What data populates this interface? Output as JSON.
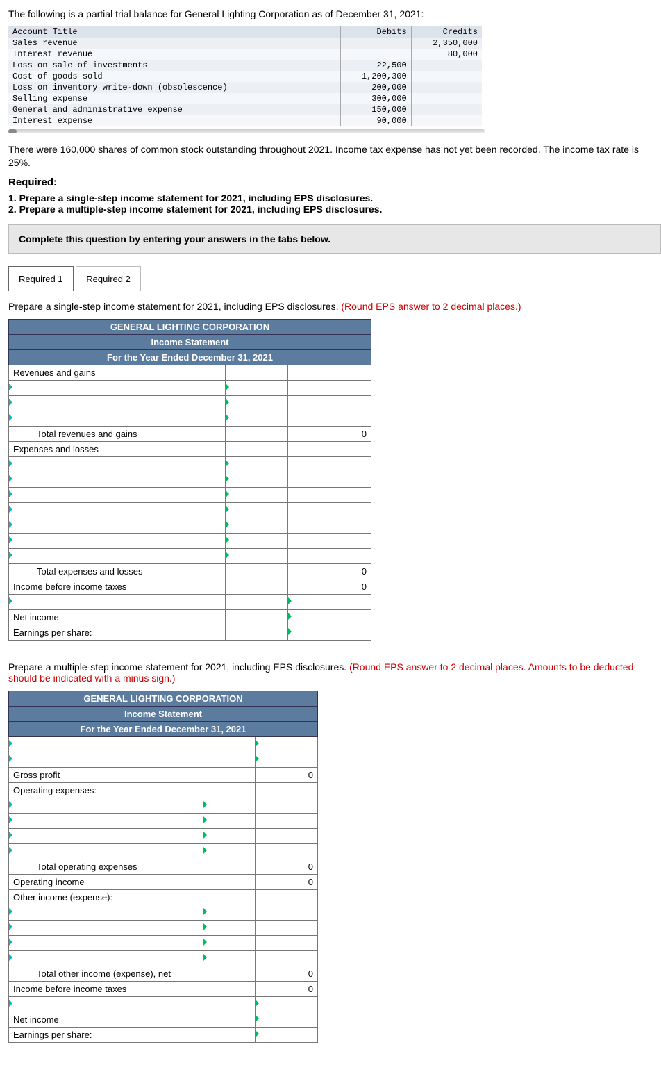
{
  "intro": "The following is a partial trial balance for General Lighting Corporation as of December 31, 2021:",
  "tb": {
    "headers": [
      "Account Title",
      "Debits",
      "Credits"
    ],
    "rows": [
      {
        "t": "Sales revenue",
        "d": "",
        "c": "2,350,000"
      },
      {
        "t": "Interest revenue",
        "d": "",
        "c": "80,000"
      },
      {
        "t": "Loss on sale of investments",
        "d": "22,500",
        "c": ""
      },
      {
        "t": "Cost of goods sold",
        "d": "1,200,300",
        "c": ""
      },
      {
        "t": "Loss on inventory write-down (obsolescence)",
        "d": "200,000",
        "c": ""
      },
      {
        "t": "Selling expense",
        "d": "300,000",
        "c": ""
      },
      {
        "t": "General and administrative expense",
        "d": "150,000",
        "c": ""
      },
      {
        "t": "Interest expense",
        "d": "90,000",
        "c": ""
      }
    ]
  },
  "para": "There were 160,000 shares of common stock outstanding throughout 2021. Income tax expense has not yet been recorded. The income tax rate is 25%.",
  "req_hd": "Required:",
  "req_list": {
    "r1": "1. Prepare a single-step income statement for 2021, including EPS disclosures.",
    "r2": "2. Prepare a multiple-step income statement for 2021, including EPS disclosures."
  },
  "graybar": "Complete this question by entering your answers in the tabs below.",
  "tabs": {
    "t1": "Required 1",
    "t2": "Required 2"
  },
  "instr1a": "Prepare a single-step income statement for 2021, including EPS disclosures. ",
  "instr1b": "(Round EPS answer to 2 decimal places.)",
  "stmt_hdr": {
    "l1": "GENERAL LIGHTING CORPORATION",
    "l2": "Income Statement",
    "l3": "For the Year Ended December 31, 2021"
  },
  "ss": {
    "rev_gains": "Revenues and gains",
    "tot_rev": "Total revenues and gains",
    "exp_losses": "Expenses and losses",
    "tot_exp": "Total expenses and losses",
    "ibt": "Income before income taxes",
    "ni": "Net income",
    "eps": "Earnings per share:",
    "zero": "0"
  },
  "instr2a": "Prepare a multiple-step income statement for 2021, including EPS disclosures. ",
  "instr2b": "(Round EPS answer to 2 decimal places. Amounts to be deducted should be indicated with a minus sign.)",
  "ms": {
    "gp": "Gross profit",
    "opex": "Operating expenses:",
    "tot_opex": "Total operating expenses",
    "opinc": "Operating income",
    "other": "Other income (expense):",
    "tot_other": "Total other income (expense), net",
    "ibt": "Income before income taxes",
    "ni": "Net income",
    "eps": "Earnings per share:",
    "zero": "0"
  }
}
